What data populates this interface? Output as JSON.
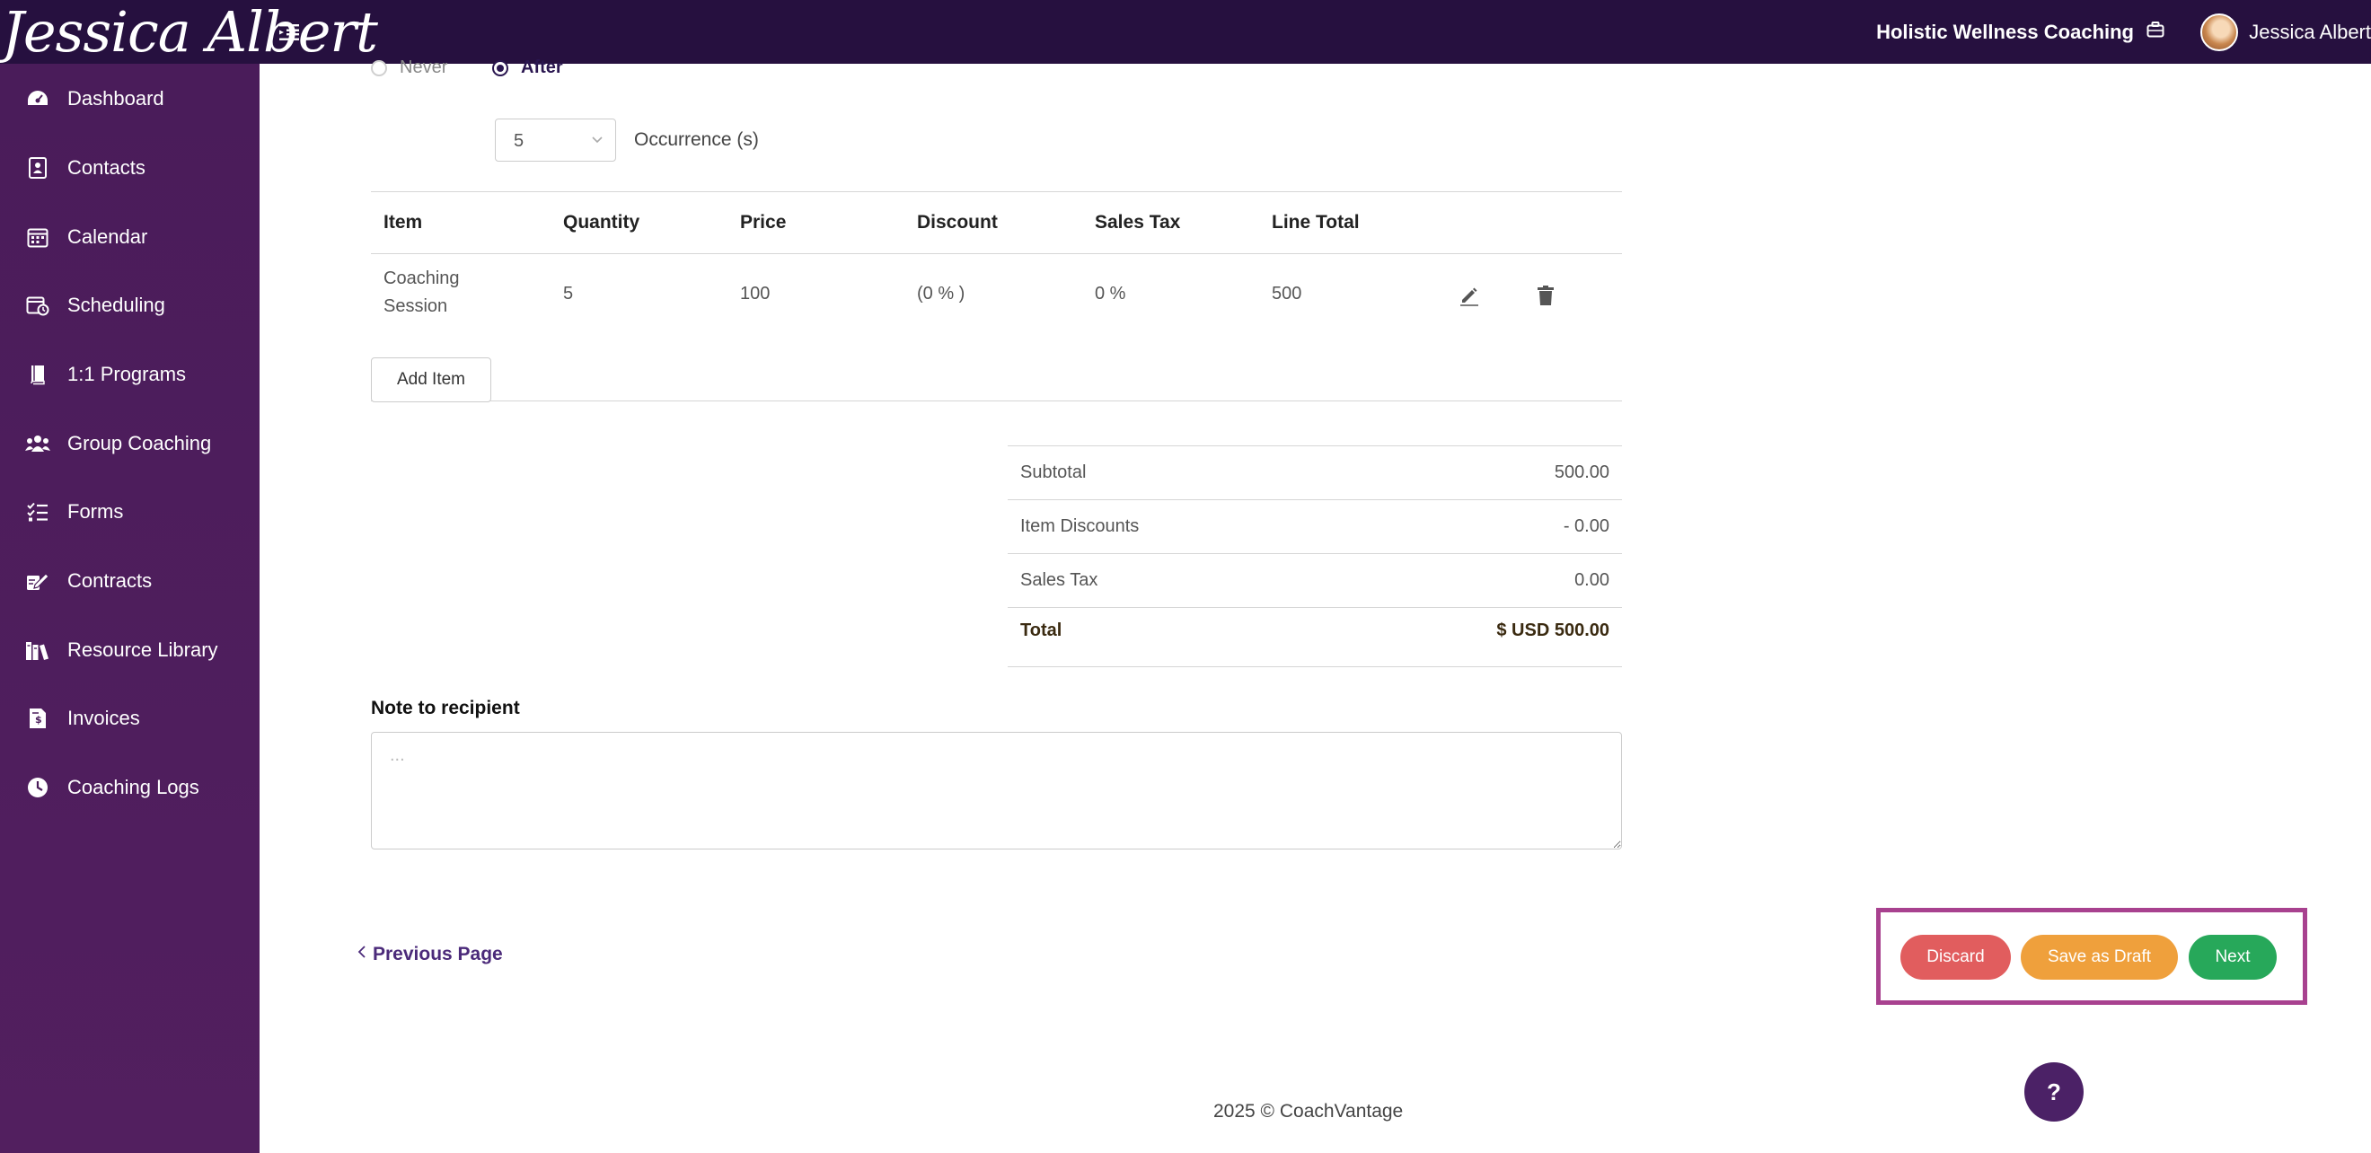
{
  "header": {
    "brand": "Jessica Albert",
    "organization": "Holistic Wellness Coaching",
    "user_name": "Jessica Albert"
  },
  "sidebar": {
    "items": [
      {
        "label": "Dashboard",
        "icon": "dashboard-icon"
      },
      {
        "label": "Contacts",
        "icon": "contacts-icon"
      },
      {
        "label": "Calendar",
        "icon": "calendar-icon"
      },
      {
        "label": "Scheduling",
        "icon": "scheduling-icon"
      },
      {
        "label": "1:1 Programs",
        "icon": "book-icon"
      },
      {
        "label": "Group Coaching",
        "icon": "group-icon"
      },
      {
        "label": "Forms",
        "icon": "checklist-icon"
      },
      {
        "label": "Contracts",
        "icon": "signature-icon"
      },
      {
        "label": "Resource Library",
        "icon": "library-icon"
      },
      {
        "label": "Invoices",
        "icon": "invoice-icon"
      },
      {
        "label": "Coaching Logs",
        "icon": "clock-icon"
      }
    ]
  },
  "recurrence": {
    "ends_options": [
      {
        "label": "Never",
        "selected": false
      },
      {
        "label": "After",
        "selected": true
      }
    ],
    "occurrences_value": "5",
    "occurrences_label": "Occurrence (s)"
  },
  "items_table": {
    "columns": [
      "Item",
      "Quantity",
      "Price",
      "Discount",
      "Sales Tax",
      "Line Total"
    ],
    "rows": [
      {
        "item": "Coaching Session",
        "quantity": "5",
        "price": "100",
        "discount": "(0 % )",
        "sales_tax": "0 %",
        "line_total": "500"
      }
    ],
    "add_item_label": "Add Item"
  },
  "totals": {
    "subtotal_label": "Subtotal",
    "subtotal_value": "500.00",
    "item_discounts_label": "Item Discounts",
    "item_discounts_value": "- 0.00",
    "sales_tax_label": "Sales Tax",
    "sales_tax_value": "0.00",
    "total_label": "Total",
    "total_value": "$ USD 500.00"
  },
  "note": {
    "label": "Note to recipient",
    "placeholder": "..."
  },
  "footer_nav": {
    "previous_label": "Previous Page",
    "discard_label": "Discard",
    "save_draft_label": "Save as Draft",
    "next_label": "Next"
  },
  "help_label": "?",
  "copyright": "2025 © CoachVantage",
  "colors": {
    "topbar": "#26103f",
    "sidebar": "#4a1c5a",
    "discard": "#e15d5e",
    "save_draft": "#efa03c",
    "next": "#27a85a",
    "highlight_frame": "#a8418f",
    "link": "#4b2a7a"
  }
}
